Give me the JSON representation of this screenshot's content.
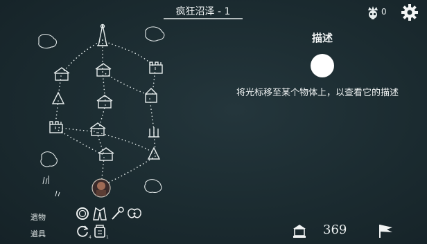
{
  "header": {
    "map_title": "疯狂沼泽 - 1",
    "skull_count": "0"
  },
  "description_panel": {
    "title": "描述",
    "text": "将光标移至某个物体上，以查看它的描述"
  },
  "inventory": {
    "relics_label": "遗物",
    "items_label": "道具",
    "relics": [
      "ring-icon",
      "coat-icon",
      "staff-icon",
      "wings-icon"
    ],
    "items": [
      {
        "icon": "refresh-icon",
        "badge": "4"
      },
      {
        "icon": "jar-icon",
        "badge": "1"
      }
    ]
  },
  "footer": {
    "gold": "369",
    "gold_icon": "shrine-icon",
    "flag_icon": "flag-icon"
  },
  "colors": {
    "background": "#1b2b30",
    "foreground": "#e8ecec"
  }
}
